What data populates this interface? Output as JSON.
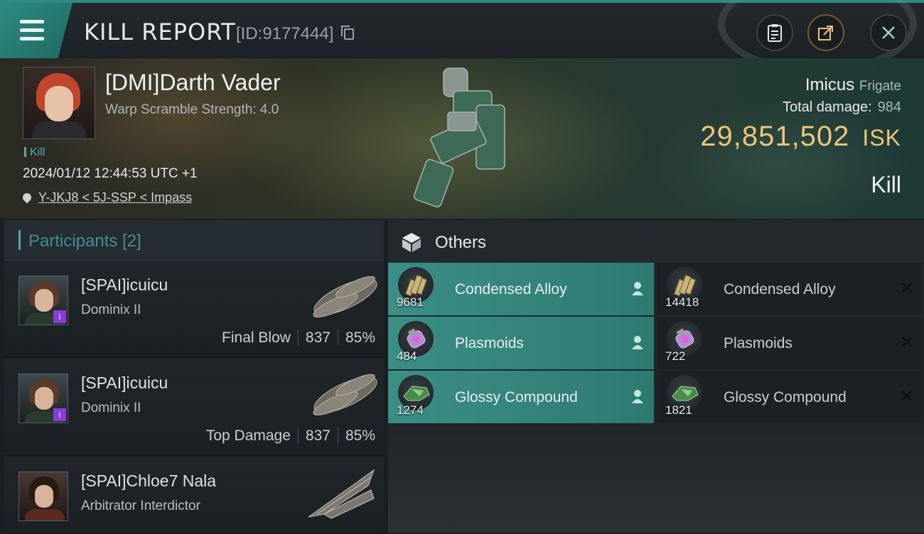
{
  "header": {
    "title": "KILL REPORT",
    "report_id": "[ID:9177444]"
  },
  "victim": {
    "name": "[DMI]Darth Vader",
    "warp_scramble": "Warp Scramble Strength: 4.0",
    "tag": "Kill",
    "datetime": "2024/01/12 12:44:53 UTC +1",
    "location": "Y-JKJ8 < 5J-SSP < Impass",
    "ship_name": "Imicus",
    "ship_class": "Frigate",
    "total_damage_label": "Total damage:",
    "total_damage": "984",
    "isk_value": "29,851,502",
    "isk_unit": "ISK",
    "result": "Kill"
  },
  "participants": {
    "title": "Participants [2]",
    "items": [
      {
        "name": "[SPAI]icuicu",
        "ship": "Dominix II",
        "role": "Final Blow",
        "damage": "837",
        "percent": "85%"
      },
      {
        "name": "[SPAI]icuicu",
        "ship": "Dominix II",
        "role": "Top Damage",
        "damage": "837",
        "percent": "85%"
      },
      {
        "name": "[SPAI]Chloe7 Nala",
        "ship": "Arbitrator Interdictor",
        "role": "",
        "damage": "",
        "percent": ""
      }
    ]
  },
  "others": {
    "title": "Others",
    "destroyed": [
      {
        "qty": "9681",
        "name": "Condensed Alloy",
        "icon": "alloy-icon"
      },
      {
        "qty": "484",
        "name": "Plasmoids",
        "icon": "plasmoid-icon"
      },
      {
        "qty": "1274",
        "name": "Glossy Compound",
        "icon": "glossy-icon"
      }
    ],
    "dropped": [
      {
        "qty": "14418",
        "name": "Condensed Alloy",
        "icon": "alloy-icon"
      },
      {
        "qty": "722",
        "name": "Plasmoids",
        "icon": "plasmoid-icon"
      },
      {
        "qty": "1821",
        "name": "Glossy Compound",
        "icon": "glossy-icon"
      }
    ]
  },
  "colors": {
    "accent": "#2e8b82",
    "isk": "#eec57a",
    "destroyed_row": "#3b8f86"
  }
}
